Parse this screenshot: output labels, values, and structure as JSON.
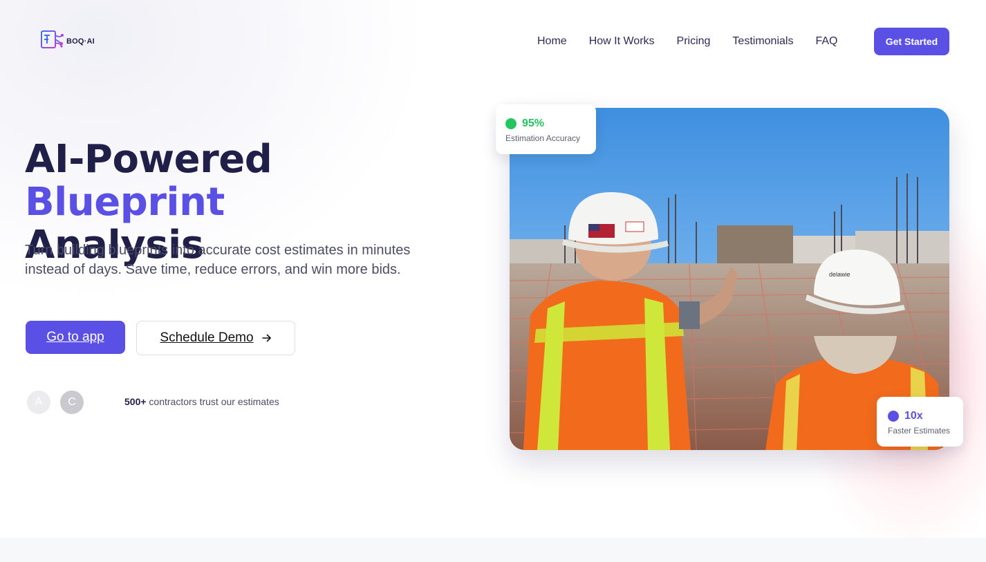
{
  "brand": {
    "name": "BOQ·AI",
    "accent": "#5b50e6"
  },
  "nav": {
    "items": [
      "Home",
      "How It Works",
      "Pricing",
      "Testimonials",
      "FAQ"
    ],
    "cta": "Get Started"
  },
  "hero": {
    "title_part1": "AI-Powered ",
    "title_accent": "Blueprint",
    "title_part2": "Analysis",
    "subtitle": "Turn building blueprints into accurate cost estimates in minutes instead of days. Save time, reduce errors, and win more bids.",
    "primary_button": "Go to app",
    "secondary_button": "Schedule Demo",
    "secondary_icon": "arrow-right-icon",
    "avatars": [
      "A",
      "C"
    ],
    "trust_count": "500+",
    "trust_text": " contractors trust our estimates"
  },
  "stats": {
    "accuracy": {
      "value": "95%",
      "label": "Estimation Accuracy",
      "color": "#22c55e"
    },
    "speed": {
      "value": "10x",
      "label": "Faster Estimates",
      "color": "#5b50e6"
    }
  },
  "photo": {
    "description_icon": "construction-site-photo"
  }
}
